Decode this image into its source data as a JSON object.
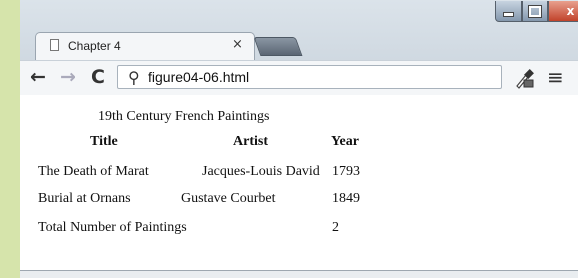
{
  "browser": {
    "tab_title": "Chapter 4",
    "tab_close": "×",
    "url": "figure04-06.html",
    "nav": {
      "back": "←",
      "forward": "→",
      "reload": "C"
    },
    "search_glyph": "⚲",
    "menu_glyph": "≡",
    "window_close": "x",
    "icons": [
      "page-icon",
      "search-icon",
      "eyedropper-icon",
      "menu-icon",
      "minimize-icon",
      "maximize-icon",
      "close-icon"
    ]
  },
  "table": {
    "caption": "19th Century French Paintings",
    "headers": [
      "Title",
      "Artist",
      "Year"
    ],
    "rows": [
      [
        "The Death of Marat",
        "Jacques-Louis David",
        "1793"
      ],
      [
        "Burial at Ornans",
        "Gustave Courbet",
        "1849"
      ]
    ],
    "footer": [
      "Total Number of Paintings",
      "2"
    ]
  }
}
